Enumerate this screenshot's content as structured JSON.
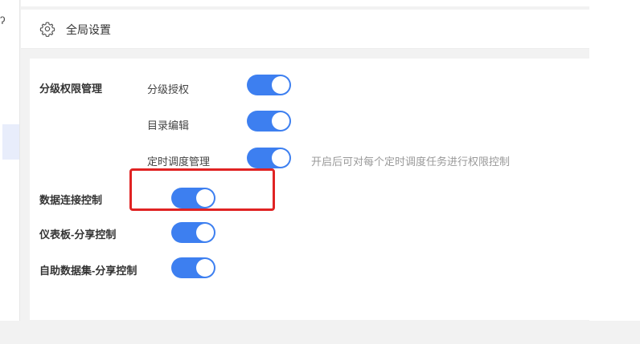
{
  "header": {
    "title": "全局设置"
  },
  "sections": {
    "hierarchy": {
      "label": "分级权限管理",
      "items": [
        {
          "label": "分级授权",
          "on": true
        },
        {
          "label": "目录编辑",
          "on": true
        },
        {
          "label": "定时调度管理",
          "on": true,
          "hint": "开启后可对每个定时调度任务进行权限控制"
        }
      ]
    },
    "data_connection": {
      "label": "数据连接控制",
      "on": true
    },
    "dashboard_share": {
      "label": "仪表板-分享控制",
      "on": true
    },
    "self_dataset_share": {
      "label": "自助数据集-分享控制",
      "on": true
    }
  },
  "colors": {
    "toggle_on": "#3d7ff0",
    "highlight": "#e02323"
  },
  "icons": [
    "gear-icon",
    "key-icon"
  ]
}
